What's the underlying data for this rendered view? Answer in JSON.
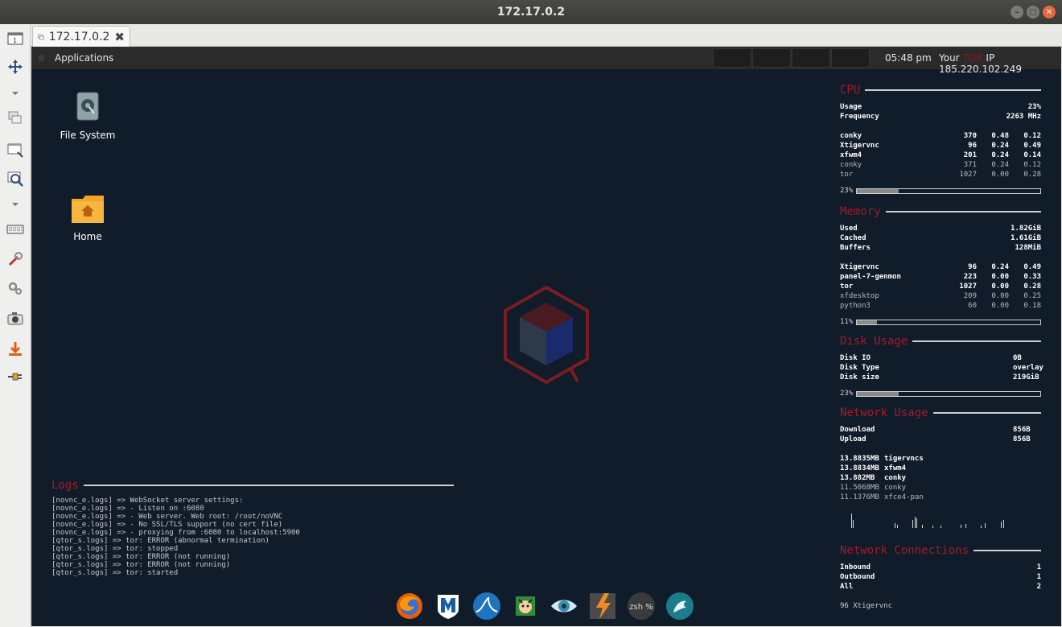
{
  "window": {
    "title": "172.17.0.2"
  },
  "tab": {
    "label": "172.17.0.2"
  },
  "panel": {
    "applications_label": "Applications",
    "clock": "05:48 pm",
    "ip_prefix": "Your",
    "ip_tor": "TOR",
    "ip_suffix": "IP 185.220.102.249"
  },
  "desktop_icons": {
    "filesystem": "File System",
    "home": "Home"
  },
  "conky": {
    "cpu": {
      "title": "CPU",
      "usage_label": "Usage",
      "usage_value": "23%",
      "freq_label": "Frequency",
      "freq_value": "2263 MHz",
      "procs": [
        {
          "name": "conky",
          "pid": "370",
          "a": "0.48",
          "b": "0.12"
        },
        {
          "name": "Xtigervnc",
          "pid": "96",
          "a": "0.24",
          "b": "0.49"
        },
        {
          "name": "xfwm4",
          "pid": "201",
          "a": "0.24",
          "b": "0.14"
        },
        {
          "name": "conky",
          "pid": "371",
          "a": "0.24",
          "b": "0.12"
        },
        {
          "name": "tor",
          "pid": "1027",
          "a": "0.00",
          "b": "0.28"
        }
      ],
      "bar_label": "23%",
      "bar_fraction": 0.23
    },
    "memory": {
      "title": "Memory",
      "used_label": "Used",
      "used_value": "1.82GiB",
      "cached_label": "Cached",
      "cached_value": "1.61GiB",
      "buffers_label": "Buffers",
      "buffers_value": "128MiB",
      "procs": [
        {
          "name": "Xtigervnc",
          "pid": "96",
          "a": "0.24",
          "b": "0.49"
        },
        {
          "name": "panel-7-genmon",
          "pid": "223",
          "a": "0.00",
          "b": "0.33"
        },
        {
          "name": "tor",
          "pid": "1027",
          "a": "0.00",
          "b": "0.28"
        },
        {
          "name": "xfdesktop",
          "pid": "209",
          "a": "0.00",
          "b": "0.25"
        },
        {
          "name": "python3",
          "pid": "60",
          "a": "0.00",
          "b": "0.18"
        }
      ],
      "bar_label": "11%",
      "bar_fraction": 0.11
    },
    "disk": {
      "title": "Disk Usage",
      "io_label": "Disk IO",
      "io_value": "0B",
      "type_label": "Disk Type",
      "type_value": "overlay",
      "size_label": "Disk size",
      "size_value": "219GiB",
      "bar_label": "23%",
      "bar_fraction": 0.23
    },
    "network": {
      "title": "Network Usage",
      "download_label": "Download",
      "download_value": "856B",
      "upload_label": "Upload",
      "upload_value": "856B",
      "procs": [
        {
          "size": "13.8835MB",
          "name": "tigervncs"
        },
        {
          "size": "13.8834MB",
          "name": "xfwm4"
        },
        {
          "size": "13.882MB",
          "name": "conky"
        },
        {
          "size": "11.5068MB",
          "name": "conky"
        },
        {
          "size": "11.1376MB",
          "name": "xfce4-pan"
        }
      ]
    },
    "connections": {
      "title": "Network Connections",
      "inbound_label": "Inbound",
      "inbound_value": "1",
      "outbound_label": "Outbound",
      "outbound_value": "1",
      "all_label": "All",
      "all_value": "2",
      "footer": "96 Xtigervnc"
    }
  },
  "logs": {
    "title": "Logs",
    "lines": [
      "[novnc_e.logs] => WebSocket server settings:",
      "[novnc_e.logs] => - Listen on :6080",
      "[novnc_e.logs] => - Web server. Web root: /root/noVNC",
      "[novnc_e.logs] => - No SSL/TLS support (no cert file)",
      "[novnc_e.logs] => - proxying from :6080 to localhost:5900",
      "[qtor_s.logs] => tor: ERROR (abnormal termination)",
      "[qtor_s.logs] => tor: stopped",
      "[qtor_s.logs] => tor: ERROR (not running)",
      "[qtor_s.logs] => tor: ERROR (not running)",
      "[qtor_s.logs] => tor: started"
    ]
  },
  "dock": {
    "terminal_label": "zsh %"
  },
  "colors": {
    "desktop_bg": "#111c2b",
    "accent_red": "#a01c2a",
    "panel_bg": "#2b2b2b"
  }
}
